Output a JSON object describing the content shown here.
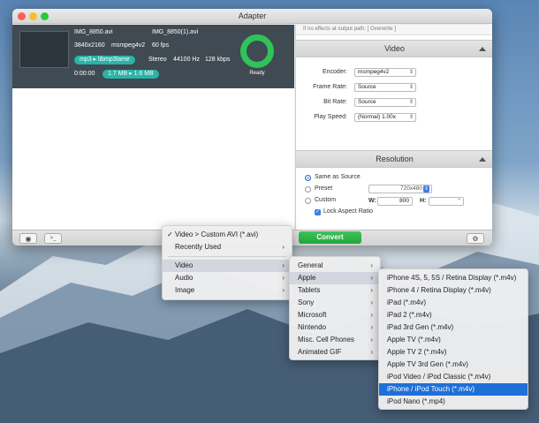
{
  "window": {
    "title": "Adapter"
  },
  "file": {
    "name": "IMG_8850.avi",
    "output_name": "IMG_8850(1).avi",
    "resolution": "3840x2160",
    "codec": "msmpeg4v2",
    "fps": "60 fps",
    "audio_codec": "mp3 ▸ libmp3lame",
    "channels": "Stereo",
    "sample_rate": "44100 Hz",
    "bitrate": "128 kbps",
    "duration": "0:00:00",
    "size": "1.7 MB ▸ 1.6 MB",
    "status": "Ready"
  },
  "right": {
    "top_strip": "If no effects at output path: [ Overwrite ]",
    "video": {
      "title": "Video",
      "encoder_label": "Encoder:",
      "encoder_value": "msmpeg4v2",
      "framerate_label": "Frame Rate:",
      "framerate_value": "Source",
      "bitrate_label": "Bit Rate:",
      "bitrate_value": "Source",
      "playspeed_label": "Play Speed:",
      "playspeed_value": "(Normal) 1.00x"
    },
    "resolution": {
      "title": "Resolution",
      "same_as_source": "Same as Source",
      "preset": "Preset",
      "preset_value": "720x480",
      "custom": "Custom",
      "w_label": "W:",
      "w_value": "800",
      "h_label": "H:",
      "lock_aspect": "Lock Aspect Ratio"
    }
  },
  "bottom": {
    "convert_label": "Convert"
  },
  "menu_main": {
    "selected": "Video > Custom AVI (*.avi)",
    "recent": "Recently Used",
    "items": [
      "Video",
      "Audio",
      "Image"
    ]
  },
  "menu_video": [
    "General",
    "Apple",
    "Tablets",
    "Sony",
    "Microsoft",
    "Nintendo",
    "Misc. Cell Phones",
    "Animated GIF"
  ],
  "menu_apple": [
    "iPhone 4S, 5, 5S / Retina Display (*.m4v)",
    "iPhone 4 / Retina Display (*.m4v)",
    "iPad (*.m4v)",
    "iPad 2 (*.m4v)",
    "iPad 3rd Gen (*.m4v)",
    "Apple TV (*.m4v)",
    "Apple TV 2 (*.m4v)",
    "Apple TV 3rd Gen (*.m4v)",
    "iPod Video / iPod Classic (*.m4v)",
    "iPhone / iPod Touch (*.m4v)",
    "iPod Nano (*.mp4)"
  ]
}
